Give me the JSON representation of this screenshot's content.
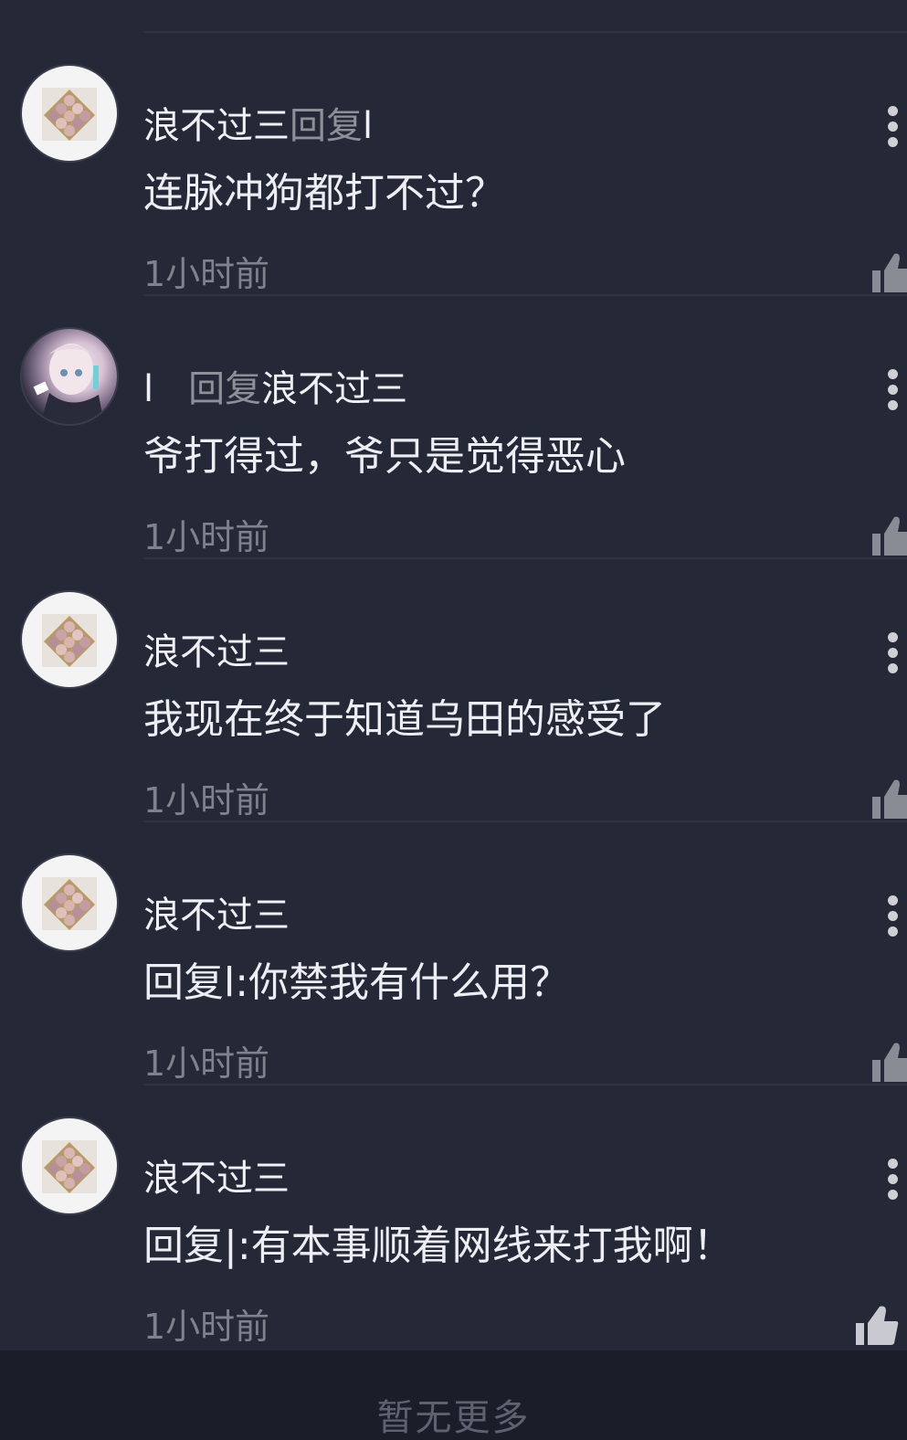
{
  "comments": [
    {
      "author": "浪不过三",
      "reply_word": "回复",
      "reply_target": "l",
      "text": "连脉冲狗都打不过？",
      "time": "1小时前"
    },
    {
      "author": "l",
      "reply_word": "回复",
      "reply_target": "浪不过三",
      "text": "爷打得过，爷只是觉得恶心",
      "time": "1小时前"
    },
    {
      "author": "浪不过三",
      "text": "我现在终于知道乌田的感受了",
      "time": "1小时前"
    },
    {
      "author": "浪不过三",
      "text": "回复l:你禁我有什么用？",
      "time": "1小时前"
    },
    {
      "author": "浪不过三",
      "text": "回复|:有本事顺着网线来打我啊！",
      "time": "1小时前"
    }
  ],
  "icons": {
    "more": "more-vertical-icon",
    "like": "thumbs-up-icon"
  },
  "colors": {
    "background": "#252836",
    "reply_word": "#8e9099",
    "time": "#7f828d",
    "footer_text": "#5e6170"
  },
  "footer": {
    "no_more": "暂无更多"
  }
}
